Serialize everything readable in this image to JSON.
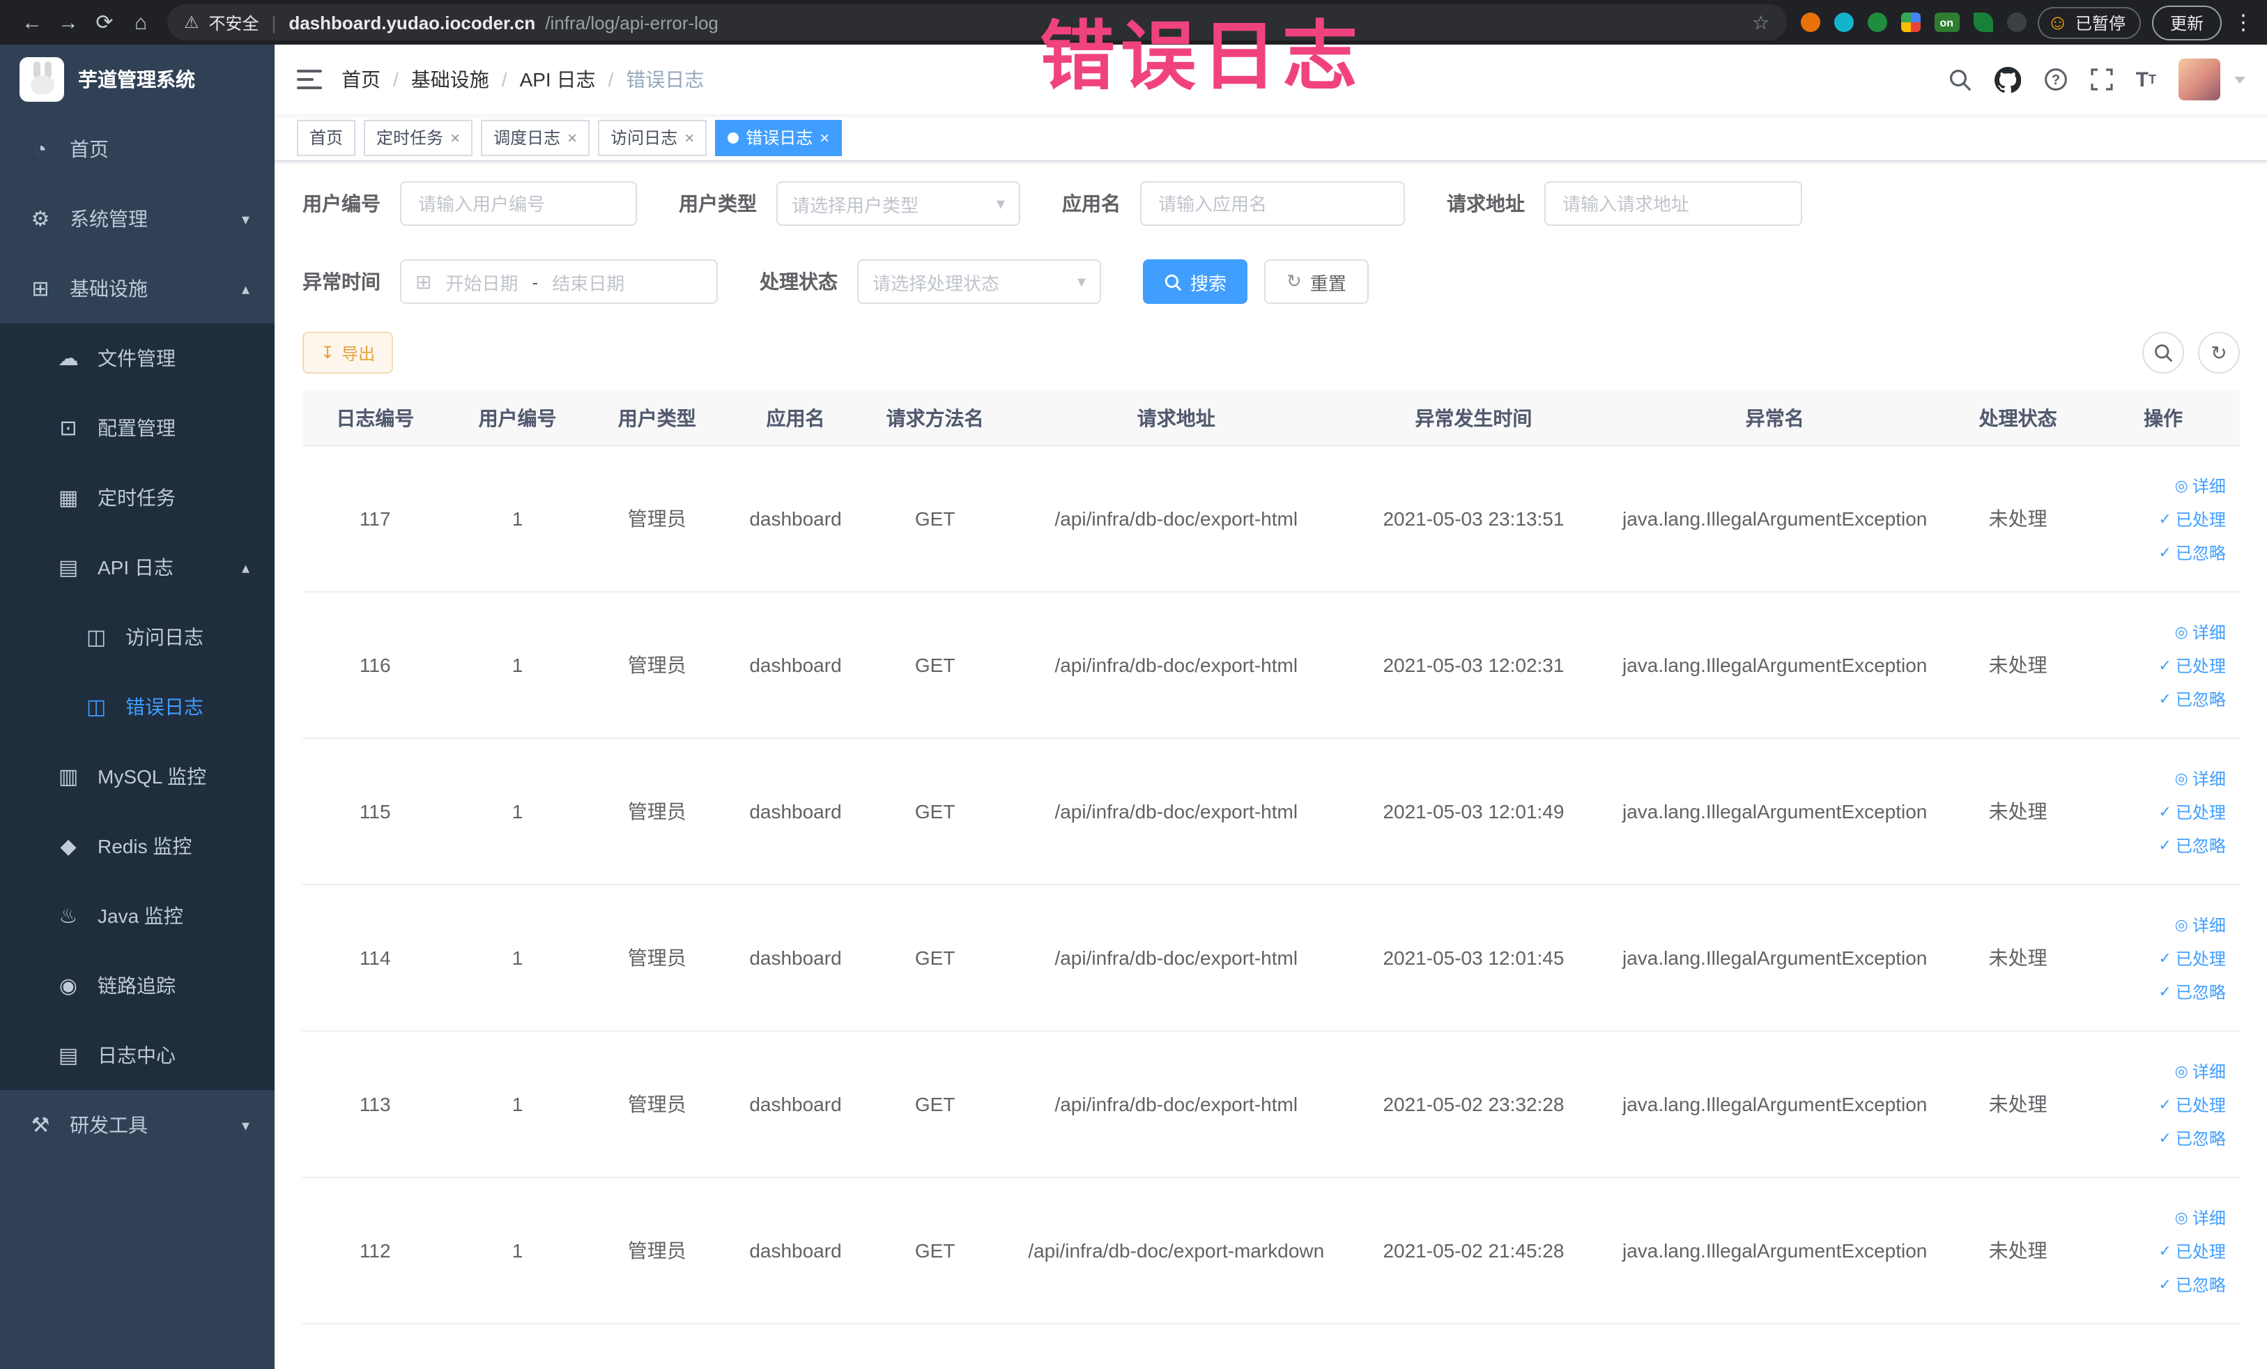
{
  "colors": {
    "accent": "#409eff",
    "sidebar_bg": "#304156",
    "submenu_bg": "#1f2d3d",
    "annotation": "#f0437e",
    "export_text": "#e6a23c",
    "browser_bar_bg": "#202124"
  },
  "icon_glyphs": {
    "back": "←",
    "forward": "→",
    "refresh": "⟳",
    "home": "⌂",
    "warning": "⚠",
    "star": "☆",
    "kebab": "⋮",
    "smiley": "☺",
    "dashboard": "◔",
    "gear": "⚙",
    "infrastructure": "⊞",
    "file": "☁",
    "config": "⊡",
    "job": "▦",
    "api_log": "▤",
    "access_log": "◫",
    "error_log": "◫",
    "mysql": "▥",
    "redis": "◆",
    "java": "♨",
    "trace": "◉",
    "log_center": "▤",
    "tools": "⚒",
    "chevron_down": "▾",
    "chevron_up": "▴",
    "close": "×",
    "calendar": "⊞",
    "select_arrow": "▾",
    "download": "↧",
    "reset": "↻",
    "eye": "◎",
    "check": "✓"
  },
  "browser": {
    "security_label": "不安全",
    "url_host": "dashboard.yudao.iocoder.cn",
    "url_path": "/infra/log/api-error-log",
    "extension_on_label": "on",
    "paused_badge": "已暂停",
    "update_button": "更新"
  },
  "annotation": {
    "text": "错误日志"
  },
  "sidebar": {
    "title": "芋道管理系统",
    "items": [
      {
        "icon": "dashboard",
        "label": "首页"
      },
      {
        "icon": "gear",
        "label": "系统管理"
      },
      {
        "icon": "infrastructure",
        "label": "基础设施"
      },
      {
        "icon": "file",
        "label": "文件管理"
      },
      {
        "icon": "config",
        "label": "配置管理"
      },
      {
        "icon": "job",
        "label": "定时任务"
      },
      {
        "icon": "api_log",
        "label": "API 日志"
      },
      {
        "icon": "access_log",
        "label": "访问日志"
      },
      {
        "icon": "error_log",
        "label": "错误日志"
      },
      {
        "icon": "mysql",
        "label": "MySQL 监控"
      },
      {
        "icon": "redis",
        "label": "Redis 监控"
      },
      {
        "icon": "java",
        "label": "Java 监控"
      },
      {
        "icon": "trace",
        "label": "链路追踪"
      },
      {
        "icon": "log_center",
        "label": "日志中心"
      },
      {
        "icon": "tools",
        "label": "研发工具"
      }
    ]
  },
  "breadcrumb": {
    "separator": "/",
    "items": [
      "首页",
      "基础设施",
      "API 日志",
      "错误日志"
    ]
  },
  "tabs": [
    {
      "label": "首页"
    },
    {
      "label": "定时任务"
    },
    {
      "label": "调度日志"
    },
    {
      "label": "访问日志"
    },
    {
      "label": "错误日志"
    }
  ],
  "filters": {
    "user_id_label": "用户编号",
    "user_id_placeholder": "请输入用户编号",
    "user_type_label": "用户类型",
    "user_type_placeholder": "请选择用户类型",
    "app_name_label": "应用名",
    "app_name_placeholder": "请输入应用名",
    "request_url_label": "请求地址",
    "request_url_placeholder": "请输入请求地址",
    "exception_time_label": "异常时间",
    "start_date_placeholder": "开始日期",
    "date_separator": "-",
    "end_date_placeholder": "结束日期",
    "process_status_label": "处理状态",
    "process_status_placeholder": "请选择处理状态",
    "search_button": "搜索",
    "reset_button": "重置"
  },
  "toolbar": {
    "export_button": "导出"
  },
  "table": {
    "columns": [
      "日志编号",
      "用户编号",
      "用户类型",
      "应用名",
      "请求方法名",
      "请求地址",
      "异常发生时间",
      "异常名",
      "处理状态",
      "操作"
    ],
    "actions": {
      "detail": "详细",
      "processed": "已处理",
      "ignored": "已忽略"
    },
    "rows": [
      {
        "log_id": "117",
        "user_id": "1",
        "user_type": "管理员",
        "app_name": "dashboard",
        "method": "GET",
        "request_url": "/api/infra/db-doc/export-html",
        "exception_time": "2021-05-03 23:13:51",
        "exception_name": "java.lang.IllegalArgumentException",
        "process_status": "未处理"
      },
      {
        "log_id": "116",
        "user_id": "1",
        "user_type": "管理员",
        "app_name": "dashboard",
        "method": "GET",
        "request_url": "/api/infra/db-doc/export-html",
        "exception_time": "2021-05-03 12:02:31",
        "exception_name": "java.lang.IllegalArgumentException",
        "process_status": "未处理"
      },
      {
        "log_id": "115",
        "user_id": "1",
        "user_type": "管理员",
        "app_name": "dashboard",
        "method": "GET",
        "request_url": "/api/infra/db-doc/export-html",
        "exception_time": "2021-05-03 12:01:49",
        "exception_name": "java.lang.IllegalArgumentException",
        "process_status": "未处理"
      },
      {
        "log_id": "114",
        "user_id": "1",
        "user_type": "管理员",
        "app_name": "dashboard",
        "method": "GET",
        "request_url": "/api/infra/db-doc/export-html",
        "exception_time": "2021-05-03 12:01:45",
        "exception_name": "java.lang.IllegalArgumentException",
        "process_status": "未处理"
      },
      {
        "log_id": "113",
        "user_id": "1",
        "user_type": "管理员",
        "app_name": "dashboard",
        "method": "GET",
        "request_url": "/api/infra/db-doc/export-html",
        "exception_time": "2021-05-02 23:32:28",
        "exception_name": "java.lang.IllegalArgumentException",
        "process_status": "未处理"
      },
      {
        "log_id": "112",
        "user_id": "1",
        "user_type": "管理员",
        "app_name": "dashboard",
        "method": "GET",
        "request_url": "/api/infra/db-doc/export-markdown",
        "exception_time": "2021-05-02 21:45:28",
        "exception_name": "java.lang.IllegalArgumentException",
        "process_status": "未处理"
      }
    ]
  }
}
